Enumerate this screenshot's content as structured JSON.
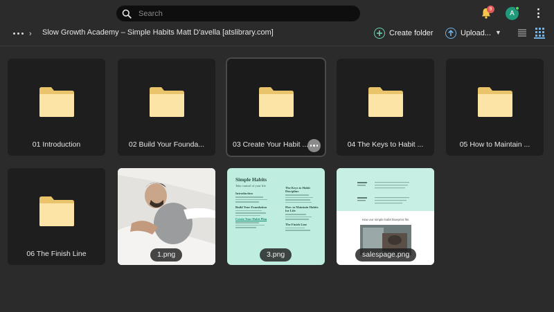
{
  "topbar": {
    "search_placeholder": "Search",
    "notification_count": "9",
    "avatar_letter": "A"
  },
  "toolbar": {
    "breadcrumb": "Slow Growth Academy – Simple Habits Matt D'avella [atslibrary.com]",
    "create_folder_label": "Create folder",
    "upload_label": "Upload...",
    "create_folder_icon": "plus-circle-icon",
    "upload_icon": "arrow-up-circle-icon",
    "accent_color": "#6fb3e8",
    "create_color": "#6fd3b0"
  },
  "folders": [
    {
      "name": "01 Introduction"
    },
    {
      "name": "02 Build Your Founda..."
    },
    {
      "name": "03 Create Your Habit ..."
    },
    {
      "name": "04 The Keys to Habit ..."
    },
    {
      "name": "05 How to Maintain ..."
    },
    {
      "name": "06 The Finish Line"
    }
  ],
  "files": [
    {
      "name": "1.png"
    },
    {
      "name": "3.png"
    },
    {
      "name": "salespage.png"
    }
  ],
  "doc_preview": {
    "title": "Simple Habits",
    "subtitle": "Take control of your life",
    "section_intro": "Introduction",
    "section_foundation": "Build Your Foundation",
    "section_create": "Create Your Habit Plan",
    "section_keys": "The Keys to Habit Discipline",
    "section_maintain": "How to Maintain Habits for Life",
    "section_finish": "The Finish Line"
  },
  "sales_preview": {
    "caption": "How our simple habit blueprint fits"
  }
}
